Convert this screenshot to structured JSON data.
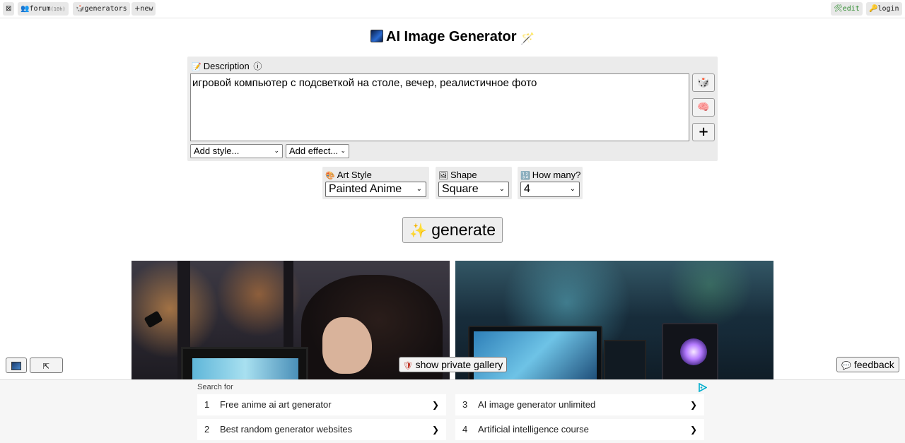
{
  "topbar": {
    "close_glyph": "⊠",
    "forum_label": "forum",
    "forum_badge": "(10h)",
    "generators_label": "generators",
    "new_label": "new",
    "edit_label": "edit",
    "login_label": "login"
  },
  "page": {
    "title": "AI Image Generator"
  },
  "description": {
    "label": "Description",
    "info_glyph": "ⓘ",
    "value": "игровой компьютер с подсветкой на столе, вечер, реалистичное фото",
    "add_style": "Add style...",
    "add_effect": "Add effect..."
  },
  "side_buttons": {
    "random_icon": "dice-icon",
    "brain_icon": "brain-icon",
    "plus_label": "+"
  },
  "options": {
    "art_style_label": "Art Style",
    "art_style_value": "Painted Anime",
    "shape_label": "Shape",
    "shape_value": "Square",
    "count_label": "How many?",
    "count_value": "4"
  },
  "generate": {
    "label": "generate"
  },
  "floating": {
    "private_gallery": "show private gallery",
    "feedback": "feedback",
    "collapse_glyph": "⇱"
  },
  "ads": {
    "search_for": "Search for",
    "items": [
      {
        "num": "1",
        "text": "Free anime ai art generator"
      },
      {
        "num": "2",
        "text": "Best random generator websites"
      },
      {
        "num": "3",
        "text": "AI image generator unlimited"
      },
      {
        "num": "4",
        "text": "Artificial intelligence course"
      }
    ],
    "arrow": "❯"
  },
  "colors": {
    "panel_bg": "#ebebeb",
    "edit_green": "#2a8a2a"
  }
}
